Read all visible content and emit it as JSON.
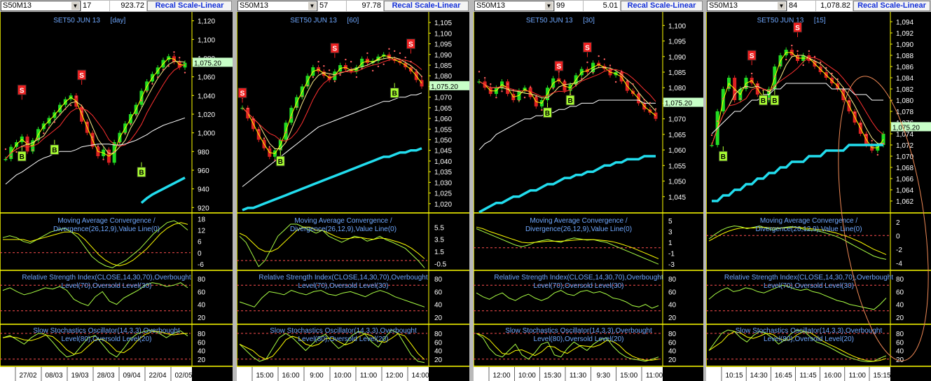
{
  "panels": [
    {
      "symbol": "S50M13",
      "count": "17",
      "value": "923.72",
      "button": "Recal Scale-Linear",
      "title": "SET50 JUN 13",
      "tf": "[day]",
      "last": "1,075.20",
      "price_ticks": [
        "1,120",
        "1,100",
        "1,080",
        "1,060",
        "1,040",
        "1,020",
        "1,000",
        "980",
        "960",
        "940",
        "920"
      ],
      "price_range": [
        915,
        1125
      ],
      "macd_label": [
        "Moving Average Convergence /",
        "Divergence(26,12,9),Value Line(0)"
      ],
      "macd_ticks": [
        "18",
        "12",
        "6",
        "0",
        "-6"
      ],
      "macd_range": [
        -9,
        20
      ],
      "rsi_label": [
        "Relative Strength Index(CLOSE,14,30,70),Overbought",
        "Level(70),Oversold Level(30)"
      ],
      "rsi_ticks": [
        "80",
        "60",
        "40",
        "20"
      ],
      "sto_label": [
        "Slow Stochastics Oscillator(14,3,3),Overbought",
        "Level(80),Oversold Level(20)"
      ],
      "sto_ticks": [
        "80",
        "60",
        "40",
        "20"
      ],
      "time_labels": [
        "27/02",
        "08/03",
        "19/03",
        "28/03",
        "09/04",
        "22/04",
        "02/05"
      ],
      "signals": [
        {
          "t": "S",
          "i": 3,
          "p": 1046
        },
        {
          "t": "B",
          "i": 3,
          "p": 975
        },
        {
          "t": "B",
          "i": 9,
          "p": 982
        },
        {
          "t": "S",
          "i": 14,
          "p": 1062
        },
        {
          "t": "B",
          "i": 25,
          "p": 958
        }
      ],
      "series": [
        972,
        985,
        990,
        996,
        980,
        992,
        1004,
        1010,
        1016,
        1022,
        1030,
        1036,
        1040,
        1028,
        1012,
        1000,
        985,
        975,
        982,
        968,
        990,
        1000,
        1010,
        1020,
        1030,
        1045,
        1055,
        1063,
        1070,
        1078,
        1082,
        1076,
        1070,
        1075
      ],
      "ma200": [
        945,
        950,
        955,
        958,
        962,
        966,
        970,
        973,
        975,
        978,
        980,
        980,
        980,
        982,
        985,
        986,
        987,
        988,
        988,
        988,
        987,
        987,
        988,
        990,
        992,
        995,
        998,
        1002,
        1005,
        1008,
        1010,
        1012,
        1014,
        1016
      ],
      "cyan": [
        0,
        0,
        0,
        0,
        0,
        0,
        0,
        0,
        0,
        0,
        0,
        0,
        0,
        0,
        0,
        0,
        0,
        0,
        0,
        0,
        0,
        0,
        0,
        0,
        0,
        925,
        930,
        934,
        937,
        940,
        943,
        946,
        949,
        952
      ],
      "macd": [
        8,
        9,
        8,
        6,
        5,
        7,
        9,
        11,
        12,
        13,
        11,
        8,
        3,
        -2,
        -5,
        -7,
        -8,
        -6,
        -4,
        -1,
        2,
        6,
        10,
        13,
        16,
        17,
        15,
        12
      ],
      "macd_sig": [
        7,
        7,
        7,
        7,
        6,
        7,
        8,
        9,
        10,
        11,
        11,
        10,
        7,
        3,
        -1,
        -4,
        -6,
        -7,
        -6,
        -4,
        -1,
        2,
        6,
        10,
        13,
        15,
        16,
        15
      ],
      "rsi": [
        62,
        66,
        60,
        55,
        58,
        62,
        66,
        64,
        68,
        62,
        48,
        42,
        38,
        52,
        60,
        45,
        40,
        50,
        56,
        62,
        70,
        74,
        72,
        68,
        70,
        74,
        66
      ],
      "sto": [
        70,
        75,
        65,
        55,
        70,
        80,
        78,
        60,
        40,
        25,
        30,
        50,
        70,
        75,
        55,
        35,
        25,
        45,
        68,
        80,
        85,
        88,
        80,
        70,
        80,
        86,
        74
      ]
    },
    {
      "symbol": "S50M13",
      "count": "57",
      "value": "97.78",
      "button": "Recal Scale-Linear",
      "title": "SET50 JUN 13",
      "tf": "[60]",
      "last": "1,075.20",
      "price_ticks": [
        "1,105",
        "1,100",
        "1,095",
        "1,090",
        "1,085",
        "1,080",
        "1,075",
        "1,070",
        "1,065",
        "1,060",
        "1,055",
        "1,050",
        "1,045",
        "1,040",
        "1,035",
        "1,030",
        "1,025",
        "1,020"
      ],
      "price_range": [
        1016,
        1108
      ],
      "macd_label": [
        "Moving Average Convergence /",
        "Divergence(26,12,9),Value Line(0)"
      ],
      "macd_ticks": [
        "5.5",
        "3.5",
        "1.5",
        "-0.5"
      ],
      "macd_range": [
        -1.5,
        7.5
      ],
      "rsi_label": [
        "Relative Strength Index(CLOSE,14,30,70),Overbought",
        "Level(70),Oversold Level(30)"
      ],
      "rsi_ticks": [
        "80",
        "60",
        "40",
        "20"
      ],
      "sto_label": [
        "Slow Stochastics Oscillator(14,3,3),Overbought",
        "Level(80),Oversold Level(20)"
      ],
      "sto_ticks": [
        "80",
        "60",
        "40",
        "20"
      ],
      "time_labels": [
        "15:00",
        "16:00",
        "9:00",
        "10:00",
        "11:00",
        "12:00",
        "14:00"
      ],
      "signals": [
        {
          "t": "S",
          "i": 0,
          "p": 1072
        },
        {
          "t": "B",
          "i": 7,
          "p": 1040
        },
        {
          "t": "S",
          "i": 17,
          "p": 1093
        },
        {
          "t": "B",
          "i": 28,
          "p": 1072
        },
        {
          "t": "S",
          "i": 31,
          "p": 1095
        }
      ],
      "series": [
        1065,
        1060,
        1055,
        1050,
        1046,
        1042,
        1045,
        1050,
        1058,
        1065,
        1070,
        1075,
        1080,
        1084,
        1082,
        1080,
        1078,
        1082,
        1085,
        1083,
        1082,
        1084,
        1088,
        1086,
        1087,
        1089,
        1090,
        1088,
        1087,
        1086,
        1084,
        1082,
        1078,
        1075
      ],
      "ma200": [
        1028,
        1030,
        1032,
        1034,
        1036,
        1038,
        1040,
        1042,
        1044,
        1046,
        1048,
        1050,
        1052,
        1054,
        1056,
        1057,
        1058,
        1059,
        1060,
        1061,
        1062,
        1063,
        1064,
        1065,
        1066,
        1067,
        1068,
        1068,
        1069,
        1070,
        1070,
        1071,
        1071,
        1072
      ],
      "cyan": [
        1017,
        1018,
        1018,
        1019,
        1020,
        1021,
        1022,
        1023,
        1024,
        1025,
        1026,
        1027,
        1028,
        1029,
        1030,
        1031,
        1032,
        1033,
        1034,
        1035,
        1036,
        1037,
        1038,
        1039,
        1040,
        1041,
        1042,
        1042,
        1043,
        1044,
        1044,
        1045,
        1045,
        1046
      ],
      "macd": [
        4,
        3,
        1,
        -1,
        0,
        2,
        4,
        5,
        6,
        6,
        5.5,
        5,
        4.5,
        5,
        4,
        3.5,
        3,
        3.5,
        4,
        3.8,
        3.2,
        3.5,
        4,
        3.4,
        3,
        2.5,
        2,
        1,
        0,
        -1.2
      ],
      "macd_sig": [
        4.5,
        4,
        3,
        2,
        1.5,
        1.5,
        2,
        3,
        4,
        5,
        5.5,
        5.5,
        5,
        5,
        4.5,
        4,
        3.6,
        3.6,
        3.8,
        3.8,
        3.6,
        3.5,
        3.7,
        3.6,
        3.3,
        3,
        2.6,
        2,
        1.2,
        0.3
      ],
      "rsi": [
        44,
        40,
        36,
        50,
        60,
        58,
        55,
        62,
        58,
        55,
        60,
        62,
        56,
        54,
        58,
        60,
        56,
        52,
        58,
        62,
        58,
        52,
        48,
        44,
        40,
        36
      ],
      "sto": [
        55,
        40,
        25,
        15,
        20,
        45,
        70,
        80,
        70,
        55,
        40,
        55,
        70,
        78,
        60,
        45,
        55,
        75,
        85,
        78,
        60,
        48,
        70,
        88,
        80,
        55,
        30,
        15,
        12
      ]
    },
    {
      "symbol": "S50M13",
      "count": "99",
      "value": "5.01",
      "button": "Recal Scale-Linear",
      "title": "SET50 JUN 13",
      "tf": "[30]",
      "last": "1,075.20",
      "price_ticks": [
        "1,100",
        "1,095",
        "1,090",
        "1,085",
        "1,080",
        "1,075",
        "1,070",
        "1,065",
        "1,060",
        "1,055",
        "1,050",
        "1,045"
      ],
      "price_range": [
        1040,
        1103
      ],
      "macd_label": [
        "Moving Average Convergence /",
        "Divergence(26,12,9),Value Line(0)"
      ],
      "macd_ticks": [
        "5",
        "3",
        "1",
        "-1",
        "-3"
      ],
      "macd_range": [
        -4,
        6
      ],
      "rsi_label": [
        "Relative Strength Index(CLOSE,14,30,70),Overbought",
        "Level(70),Oversold Level(30)"
      ],
      "rsi_ticks": [
        "80",
        "60",
        "40",
        "20"
      ],
      "sto_label": [
        "Slow Stochastics Oscillator(14,3,3),Overbought",
        "Level(80),Oversold Level(20)"
      ],
      "sto_ticks": [
        "80",
        "60",
        "40",
        "20"
      ],
      "time_labels": [
        "12:00",
        "10:00",
        "15:30",
        "11:30",
        "9:30",
        "15:00",
        "11:00"
      ],
      "signals": [
        {
          "t": "S",
          "i": 14,
          "p": 1087
        },
        {
          "t": "B",
          "i": 12,
          "p": 1072
        },
        {
          "t": "B",
          "i": 16,
          "p": 1076
        },
        {
          "t": "S",
          "i": 19,
          "p": 1093
        }
      ],
      "series": [
        1082,
        1080,
        1078,
        1080,
        1082,
        1078,
        1076,
        1079,
        1080,
        1077,
        1074,
        1076,
        1080,
        1083,
        1082,
        1079,
        1081,
        1084,
        1086,
        1085,
        1088,
        1087,
        1086,
        1084,
        1085,
        1082,
        1079,
        1078,
        1075,
        1073,
        1072,
        1070
      ],
      "ma200": [
        1060,
        1062,
        1063,
        1065,
        1066,
        1067,
        1068,
        1069,
        1070,
        1070,
        1071,
        1071,
        1072,
        1072,
        1073,
        1073,
        1074,
        1074,
        1075,
        1075,
        1075,
        1076,
        1076,
        1076,
        1076,
        1076,
        1076,
        1076,
        1076,
        1075,
        1075,
        1075
      ],
      "cyan": [
        1040,
        1041,
        1042,
        1043,
        1043,
        1044,
        1045,
        1045,
        1046,
        1047,
        1047,
        1048,
        1049,
        1049,
        1050,
        1051,
        1051,
        1052,
        1052,
        1053,
        1053,
        1054,
        1055,
        1055,
        1056,
        1056,
        1057,
        1057,
        1057,
        1058,
        1058,
        1058
      ],
      "macd": [
        3.5,
        3,
        2.5,
        2,
        1.5,
        1,
        0.5,
        0.2,
        0.5,
        1,
        1.3,
        1.5,
        1.2,
        1,
        1.5,
        1.8,
        1.6,
        1.4,
        1.5,
        1.2,
        1,
        0.5,
        0,
        -0.5,
        -1,
        -1.5,
        -2,
        -2.5,
        -3
      ],
      "macd_sig": [
        3.8,
        3.5,
        3,
        2.6,
        2.2,
        1.8,
        1.4,
        1,
        0.9,
        1,
        1.1,
        1.2,
        1.2,
        1.2,
        1.3,
        1.4,
        1.5,
        1.5,
        1.5,
        1.4,
        1.3,
        1.1,
        0.8,
        0.4,
        0,
        -0.5,
        -1,
        -1.5,
        -2
      ],
      "rsi": [
        58,
        52,
        48,
        54,
        58,
        50,
        46,
        52,
        56,
        50,
        46,
        50,
        58,
        62,
        56,
        54,
        60,
        62,
        58,
        60,
        56,
        50,
        48,
        44,
        38,
        36,
        40,
        34,
        38
      ],
      "sto": [
        80,
        70,
        45,
        30,
        25,
        40,
        55,
        30,
        20,
        35,
        55,
        60,
        30,
        25,
        45,
        60,
        50,
        40,
        55,
        65,
        70,
        50,
        35,
        25,
        20,
        18,
        15,
        20,
        25
      ]
    },
    {
      "symbol": "S50M13",
      "count": "84",
      "value": "1,078.82",
      "button": "Recal Scale-Linear",
      "title": "SET50 JUN 13",
      "tf": "[15]",
      "last": "1,075.20",
      "price_ticks": [
        "1,094",
        "1,092",
        "1,090",
        "1,088",
        "1,086",
        "1,084",
        "1,082",
        "1,080",
        "1,078",
        "1,076",
        "1,074",
        "1,072",
        "1,070",
        "1,068",
        "1,066",
        "1,064",
        "1,062"
      ],
      "price_range": [
        1060,
        1095
      ],
      "macd_label": [
        "Moving Average Convergence /",
        "Divergence(26,12,9),Value Line(0)"
      ],
      "macd_ticks": [
        "2",
        "0",
        "-2",
        "-4"
      ],
      "macd_range": [
        -5,
        3
      ],
      "rsi_label": [
        "Relative Strength Index(CLOSE,14,30,70),Overbought",
        "Level(70),Oversold Level(30)"
      ],
      "rsi_ticks": [
        "80",
        "60",
        "40",
        "20"
      ],
      "sto_label": [
        "Slow Stochastics Oscillator(14,3,3),Overbought",
        "Level(80),Oversold Level(20)"
      ],
      "sto_ticks": [
        "80",
        "60",
        "40",
        "20"
      ],
      "time_labels": [
        "10:15",
        "14:30",
        "16:45",
        "11:45",
        "16:00",
        "11:00",
        "15:15"
      ],
      "signals": [
        {
          "t": "B",
          "i": 2,
          "p": 1070
        },
        {
          "t": "S",
          "i": 7,
          "p": 1088
        },
        {
          "t": "B",
          "i": 9,
          "p": 1080
        },
        {
          "t": "B",
          "i": 11,
          "p": 1080
        },
        {
          "t": "S",
          "i": 15,
          "p": 1093
        }
      ],
      "series": [
        1072,
        1078,
        1082,
        1084,
        1080,
        1082,
        1084,
        1083,
        1081,
        1080,
        1082,
        1086,
        1088,
        1089,
        1088,
        1087,
        1088,
        1087,
        1086,
        1085,
        1084,
        1083,
        1082,
        1080,
        1078,
        1076,
        1074,
        1072,
        1071,
        1072,
        1074
      ],
      "ma200": [
        1074,
        1075,
        1076,
        1077,
        1078,
        1078,
        1079,
        1080,
        1080,
        1081,
        1081,
        1082,
        1082,
        1083,
        1083,
        1083,
        1083,
        1083,
        1083,
        1083,
        1083,
        1082,
        1082,
        1082,
        1082,
        1081,
        1081,
        1081,
        1080,
        1080,
        1080
      ],
      "cyan": [
        1062,
        1062,
        1063,
        1063,
        1064,
        1064,
        1065,
        1065,
        1066,
        1066,
        1067,
        1067,
        1068,
        1068,
        1069,
        1069,
        1069,
        1070,
        1070,
        1070,
        1071,
        1071,
        1071,
        1071,
        1072,
        1072,
        1072,
        1072,
        1072,
        1072,
        1072
      ],
      "macd": [
        -0.5,
        0.2,
        0.8,
        1.2,
        1.4,
        1.3,
        1,
        1.2,
        1.4,
        1.1,
        0.8,
        1,
        1.2,
        1.3,
        1.2,
        0.9,
        0.8,
        0.7,
        0.5,
        0.2,
        -0.1,
        -0.5,
        -1,
        -1.5,
        -2,
        -2.5,
        -3,
        -3.3,
        -3.5
      ],
      "macd_sig": [
        -0.8,
        -0.3,
        0.2,
        0.6,
        0.9,
        1.1,
        1.1,
        1.1,
        1.2,
        1.2,
        1.1,
        1.1,
        1.1,
        1.2,
        1.2,
        1.1,
        1,
        0.9,
        0.8,
        0.6,
        0.4,
        0.1,
        -0.2,
        -0.6,
        -1,
        -1.5,
        -2,
        -2.4,
        -2.8
      ],
      "rsi": [
        48,
        56,
        62,
        66,
        60,
        62,
        66,
        64,
        60,
        58,
        62,
        66,
        70,
        68,
        64,
        62,
        64,
        60,
        58,
        54,
        50,
        46,
        44,
        40,
        38,
        36,
        34,
        32,
        40,
        50
      ],
      "sto": [
        40,
        60,
        80,
        88,
        85,
        70,
        60,
        75,
        85,
        80,
        70,
        55,
        65,
        80,
        88,
        85,
        72,
        60,
        55,
        48,
        40,
        32,
        25,
        20,
        16,
        14,
        15,
        22,
        28
      ]
    }
  ],
  "colors": {
    "bg": "#000000",
    "price_axis_text": "#ffffff",
    "title": "#6fa8ff",
    "bull": "#22dd22",
    "bear": "#dd2222",
    "ma_yellow": "#ffff00",
    "ma_red": "#ff3030",
    "ma_white": "#ffffff",
    "cyan": "#22ddee",
    "psar": "#ff6060",
    "level": "#ff5050",
    "lime": "#aaff44",
    "axis_line": "#ffff00",
    "last_bg": "#c8ffc8",
    "buy": "#aaff33",
    "sell": "#ee2222"
  }
}
